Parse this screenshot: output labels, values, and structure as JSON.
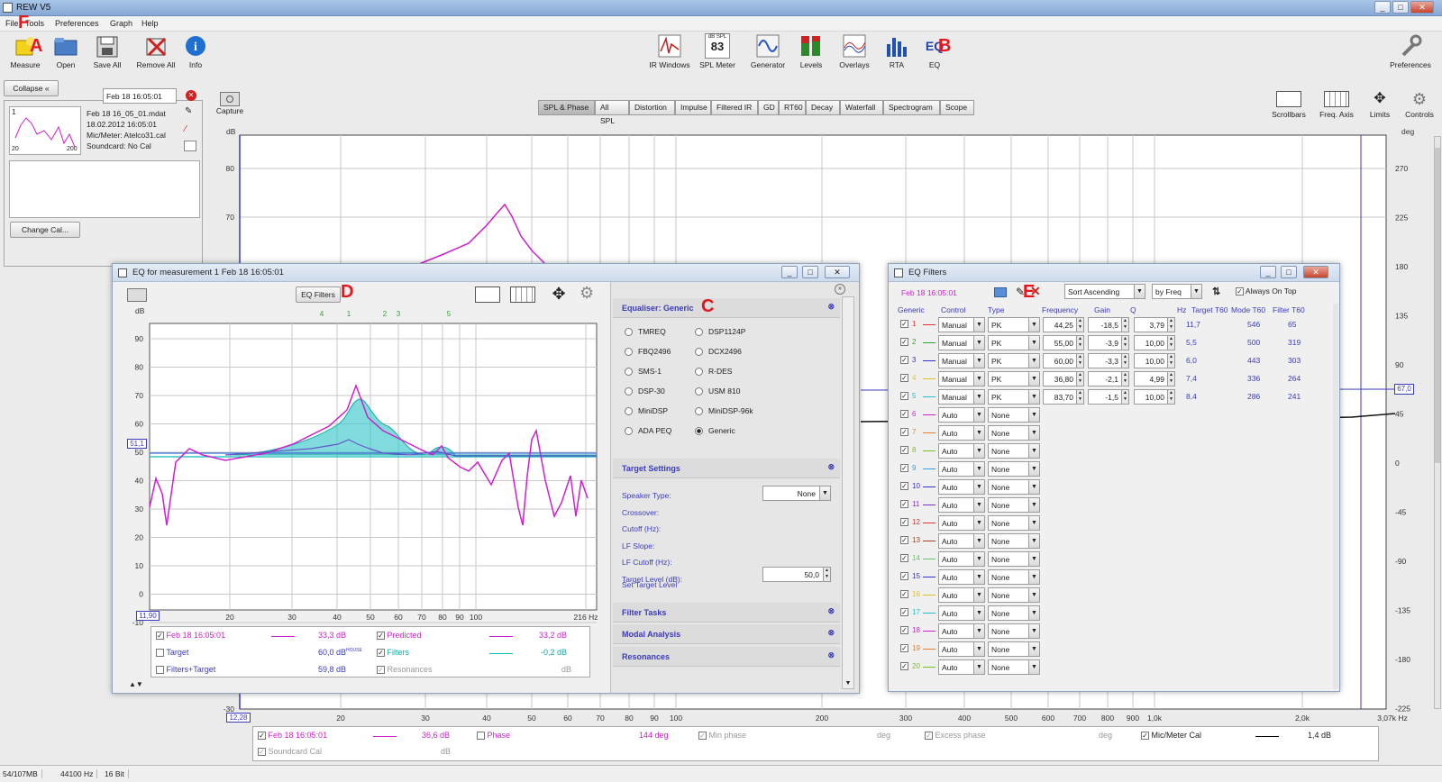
{
  "window": {
    "title": "REW V5"
  },
  "menu": [
    "File",
    "Tools",
    "Preferences",
    "Graph",
    "Help"
  ],
  "toolbar_left": [
    {
      "label": "Measure",
      "icon": "measure-icon"
    },
    {
      "label": "Open",
      "icon": "open-folder-icon"
    },
    {
      "label": "Save All",
      "icon": "save-icon"
    },
    {
      "label": "Remove All",
      "icon": "remove-icon"
    },
    {
      "label": "Info",
      "icon": "info-icon"
    }
  ],
  "toolbar_center": [
    {
      "label": "IR Windows",
      "icon": "ir-windows-icon"
    },
    {
      "label": "SPL Meter",
      "icon": "spl-meter-icon",
      "top": "dB SPL",
      "value": "83"
    },
    {
      "label": "Generator",
      "icon": "generator-icon"
    },
    {
      "label": "Levels",
      "icon": "levels-icon"
    },
    {
      "label": "Overlays",
      "icon": "overlays-icon"
    },
    {
      "label": "RTA",
      "icon": "rta-icon"
    },
    {
      "label": "EQ",
      "icon": "eq-icon",
      "text": "EQ"
    }
  ],
  "toolbar_right": {
    "label": "Preferences"
  },
  "annotations": {
    "a": "A",
    "b": "B",
    "c": "C",
    "d": "D",
    "e": "E",
    "f": "F"
  },
  "left_panel": {
    "collapse": "Collapse",
    "selected": "Feb 18 16:05:01",
    "thumb_index": "1",
    "thumb_x_min": "20",
    "thumb_x_max": "200",
    "meta": [
      "Feb 18 16_05_01.mdat",
      "18.02.2012 16:05:01",
      "Mic/Meter: Atelco31.cal",
      "Soundcard: No Cal"
    ],
    "change_cal": "Change Cal..."
  },
  "capture": "Capture",
  "graph_tabs": [
    "SPL & Phase",
    "All SPL",
    "Distortion",
    "Impulse",
    "Filtered IR",
    "GD",
    "RT60",
    "Decay",
    "Waterfall",
    "Spectrogram",
    "Scope"
  ],
  "graph_tools": [
    "Scrollbars",
    "Freq. Axis",
    "Limits",
    "Controls"
  ],
  "main_graph": {
    "ylabel": "dB",
    "ylabel_right": "deg",
    "y_ticks": [
      "80",
      "70",
      "-30"
    ],
    "y_right_ticks": [
      "270",
      "225",
      "180",
      "135",
      "90",
      "45",
      "0",
      "-45",
      "-90",
      "-135",
      "-180",
      "-225"
    ],
    "right_marker": "67,0",
    "left_marker": "12,28",
    "x_ticks": [
      "20",
      "30",
      "40",
      "50",
      "60",
      "70",
      "80",
      "90",
      "100",
      "200",
      "300",
      "400",
      "500",
      "600",
      "700",
      "800",
      "900",
      "1,0k",
      "2,0k",
      "3,07k Hz"
    ],
    "legend": [
      {
        "checked": true,
        "name": "Feb 18 16:05:01",
        "value": "36,6 dB",
        "color": "#cc22cc"
      },
      {
        "checked": false,
        "name": "Phase",
        "value": "144 deg",
        "color": "#cc22cc"
      },
      {
        "checked": true,
        "name": "Min phase",
        "value": "deg",
        "disabled": true
      },
      {
        "checked": true,
        "name": "Excess phase",
        "value": "deg",
        "disabled": true
      },
      {
        "checked": true,
        "name": "Mic/Meter Cal",
        "value": "1,4 dB",
        "color": "#000000"
      },
      {
        "checked": true,
        "name": "Soundcard Cal",
        "value": "dB",
        "disabled": true
      }
    ]
  },
  "eq_window": {
    "title": "EQ for measurement 1 Feb 18 16:05:01",
    "eq_filters_btn": "EQ Filters",
    "filter_markers": [
      "4",
      "1",
      "2",
      "3",
      "5"
    ],
    "ylabel": "dB",
    "y_ticks": [
      "90",
      "80",
      "70",
      "60",
      "50",
      "40",
      "30",
      "20",
      "10",
      "0",
      "-10"
    ],
    "left_marker": "51,1",
    "x_start": "11,90",
    "x_ticks": [
      "20",
      "30",
      "40",
      "50",
      "60",
      "70",
      "80",
      "90",
      "100",
      "216 Hz"
    ],
    "legend": [
      {
        "checked": true,
        "name": "Feb 18 16:05:01",
        "value": "33,3 dB",
        "color": "#cc22cc"
      },
      {
        "checked": true,
        "name": "Predicted",
        "value": "33,2 dB",
        "color": "#cc22cc"
      },
      {
        "checked": false,
        "name": "Target",
        "value": "60,0 dB",
        "sup": "HOUSE"
      },
      {
        "checked": true,
        "name": "Filters",
        "value": "-0,2 dB",
        "color": "#11bbbb"
      },
      {
        "checked": false,
        "name": "Filters+Target",
        "value": "59,8 dB"
      },
      {
        "checked": true,
        "name": "Resonances",
        "value": "dB",
        "disabled": true
      }
    ],
    "equaliser_title": "Equaliser: Generic",
    "equalisers": [
      "TMREQ",
      "DSP1124P",
      "FBQ2496",
      "DCX2496",
      "SMS-1",
      "R-DES",
      "DSP-30",
      "USM 810",
      "MiniDSP",
      "MiniDSP-96k",
      "ADA PEQ",
      "Generic"
    ],
    "selected_equaliser": "Generic",
    "target_title": "Target Settings",
    "target_fields": [
      "Speaker Type:",
      "Crossover:",
      "Cutoff (Hz):",
      "LF Slope:",
      "LF Cutoff (Hz):",
      "Target Level (dB):"
    ],
    "speaker_type": "None",
    "target_level": "50,0",
    "set_target": "Set Target Level",
    "sections": [
      "Filter Tasks",
      "Modal Analysis",
      "Resonances"
    ]
  },
  "eqf_window": {
    "title": "EQ Filters",
    "date": "Feb 18 16:05:01",
    "sort": "Sort Ascending",
    "by": "by Freq",
    "always_on_top": "Always On Top",
    "headers": [
      "Generic",
      "Control",
      "Type",
      "Frequency",
      "Gain",
      "Q",
      "Hz",
      "Target T60",
      "Mode T60",
      "Filter T60"
    ],
    "rows": [
      {
        "n": "1",
        "color": "#e03030",
        "control": "Manual",
        "type": "PK",
        "freq": "44,25",
        "gain": "-18,5",
        "q": "3,79",
        "hz": "11,7",
        "mode": "546",
        "filt": "65"
      },
      {
        "n": "2",
        "color": "#2aa82a",
        "control": "Manual",
        "type": "PK",
        "freq": "55,00",
        "gain": "-3,9",
        "q": "10,00",
        "hz": "5,5",
        "mode": "500",
        "filt": "319"
      },
      {
        "n": "3",
        "color": "#3030d0",
        "control": "Manual",
        "type": "PK",
        "freq": "60,00",
        "gain": "-3,3",
        "q": "10,00",
        "hz": "6,0",
        "mode": "443",
        "filt": "303"
      },
      {
        "n": "4",
        "color": "#e0c020",
        "control": "Manual",
        "type": "PK",
        "freq": "36,80",
        "gain": "-2,1",
        "q": "4,99",
        "hz": "7,4",
        "mode": "336",
        "filt": "264"
      },
      {
        "n": "5",
        "color": "#20c0d0",
        "control": "Manual",
        "type": "PK",
        "freq": "83,70",
        "gain": "-1,5",
        "q": "10,00",
        "hz": "8,4",
        "mode": "286",
        "filt": "241"
      },
      {
        "n": "6",
        "color": "#cc22cc",
        "control": "Auto",
        "type": "None"
      },
      {
        "n": "7",
        "color": "#e08030",
        "control": "Auto",
        "type": "None"
      },
      {
        "n": "8",
        "color": "#7cc020",
        "control": "Auto",
        "type": "None"
      },
      {
        "n": "9",
        "color": "#30a0e0",
        "control": "Auto",
        "type": "None"
      },
      {
        "n": "10",
        "color": "#3030d0",
        "control": "Auto",
        "type": "None"
      },
      {
        "n": "11",
        "color": "#8030c0",
        "control": "Auto",
        "type": "None"
      },
      {
        "n": "12",
        "color": "#e03030",
        "control": "Auto",
        "type": "None"
      },
      {
        "n": "13",
        "color": "#a04020",
        "control": "Auto",
        "type": "None"
      },
      {
        "n": "14",
        "color": "#70c070",
        "control": "Auto",
        "type": "None"
      },
      {
        "n": "15",
        "color": "#3030d0",
        "control": "Auto",
        "type": "None"
      },
      {
        "n": "16",
        "color": "#e0c020",
        "control": "Auto",
        "type": "None"
      },
      {
        "n": "17",
        "color": "#20c0d0",
        "control": "Auto",
        "type": "None"
      },
      {
        "n": "18",
        "color": "#cc22cc",
        "control": "Auto",
        "type": "None"
      },
      {
        "n": "19",
        "color": "#e08030",
        "control": "Auto",
        "type": "None"
      },
      {
        "n": "20",
        "color": "#7cc020",
        "control": "Auto",
        "type": "None"
      }
    ]
  },
  "status": [
    "54/107MB",
    "44100 Hz",
    "16 Bit"
  ]
}
